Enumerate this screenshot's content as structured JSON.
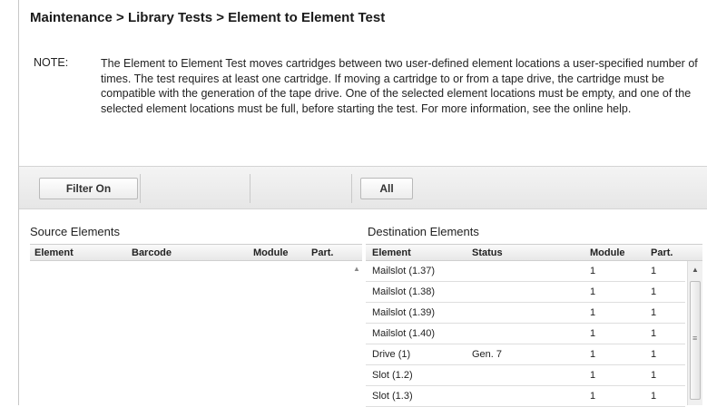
{
  "header": {
    "breadcrumb": "Maintenance > Library Tests > Element to Element Test"
  },
  "note": {
    "label": "NOTE:",
    "text": "The Element to Element Test moves cartridges between two user-defined element locations a user-specified number of times. The test requires at least one cartridge. If moving a cartridge to or from a tape drive, the cartridge must be compatible with the generation of the tape drive. One of the selected element locations must be empty, and one of the selected element locations must be full, before starting the test. For more information, see the online help."
  },
  "toolbar": {
    "filter_label": "Filter On",
    "all_label": "All"
  },
  "source": {
    "title": "Source Elements",
    "columns": [
      "Element",
      "Barcode",
      "Module",
      "Part."
    ],
    "rows": []
  },
  "destination": {
    "title": "Destination Elements",
    "columns": [
      "Element",
      "Status",
      "Module",
      "Part."
    ],
    "rows": [
      {
        "element": "Mailslot (1.37)",
        "status": "",
        "module": "1",
        "part": "1"
      },
      {
        "element": "Mailslot (1.38)",
        "status": "",
        "module": "1",
        "part": "1"
      },
      {
        "element": "Mailslot (1.39)",
        "status": "",
        "module": "1",
        "part": "1"
      },
      {
        "element": "Mailslot (1.40)",
        "status": "",
        "module": "1",
        "part": "1"
      },
      {
        "element": "Drive (1)",
        "status": "Gen. 7",
        "module": "1",
        "part": "1"
      },
      {
        "element": "Slot (1.2)",
        "status": "",
        "module": "1",
        "part": "1"
      },
      {
        "element": "Slot (1.3)",
        "status": "",
        "module": "1",
        "part": "1"
      }
    ]
  },
  "icons": {
    "scroll_up": "scroll-up-icon",
    "scroll_grip": "grip-icon"
  }
}
